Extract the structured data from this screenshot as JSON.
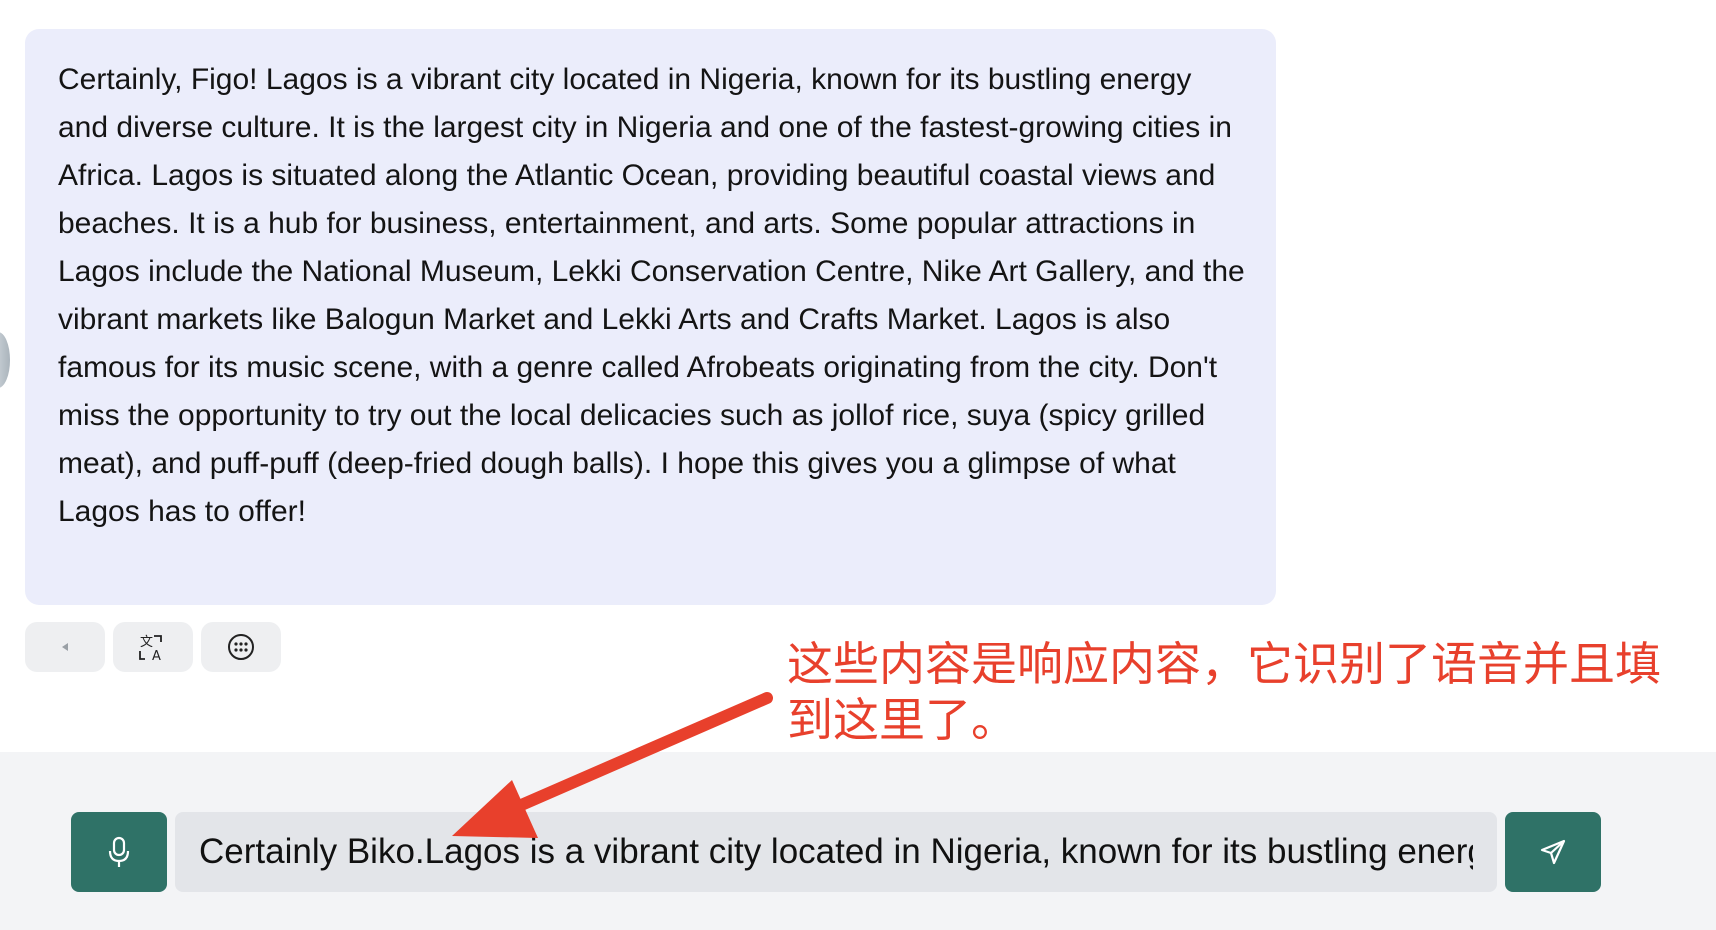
{
  "chat": {
    "assistant_message": "Certainly, Figo! Lagos is a vibrant city located in Nigeria, known for its bustling energy and diverse culture. It is the largest city in Nigeria and one of the fastest-growing cities in Africa. Lagos is situated along the Atlantic Ocean, providing beautiful coastal views and beaches. It is a hub for business, entertainment, and arts. Some popular attractions in Lagos include the National Museum, Lekki Conservation Centre, Nike Art Gallery, and the vibrant markets like Balogun Market and Lekki Arts and Crafts Market. Lagos is also famous for its music scene, with a genre called Afrobeats originating from the city. Don't miss the opportunity to try out the local delicacies such as jollof rice, suya (spicy grilled meat), and puff-puff (deep-fried dough balls). I hope this gives you a glimpse of what Lagos has to offer!"
  },
  "message_actions": {
    "icons": [
      "play-icon",
      "translate-icon",
      "more-options-icon"
    ]
  },
  "annotation": {
    "text": "这些内容是响应内容，它识别了语音并且填到这里了。",
    "color": "#e8402c"
  },
  "composer": {
    "input_value": "Certainly Biko.Lagos is a vibrant city located in Nigeria, known for its bustling energy and diverse culture.",
    "mic_icon": "microphone-icon",
    "send_icon": "send-icon"
  },
  "colors": {
    "bubble_background": "#ebedfb",
    "accent_button": "#2f7267",
    "input_background": "#e3e5e9",
    "composer_background": "#f3f4f6"
  }
}
